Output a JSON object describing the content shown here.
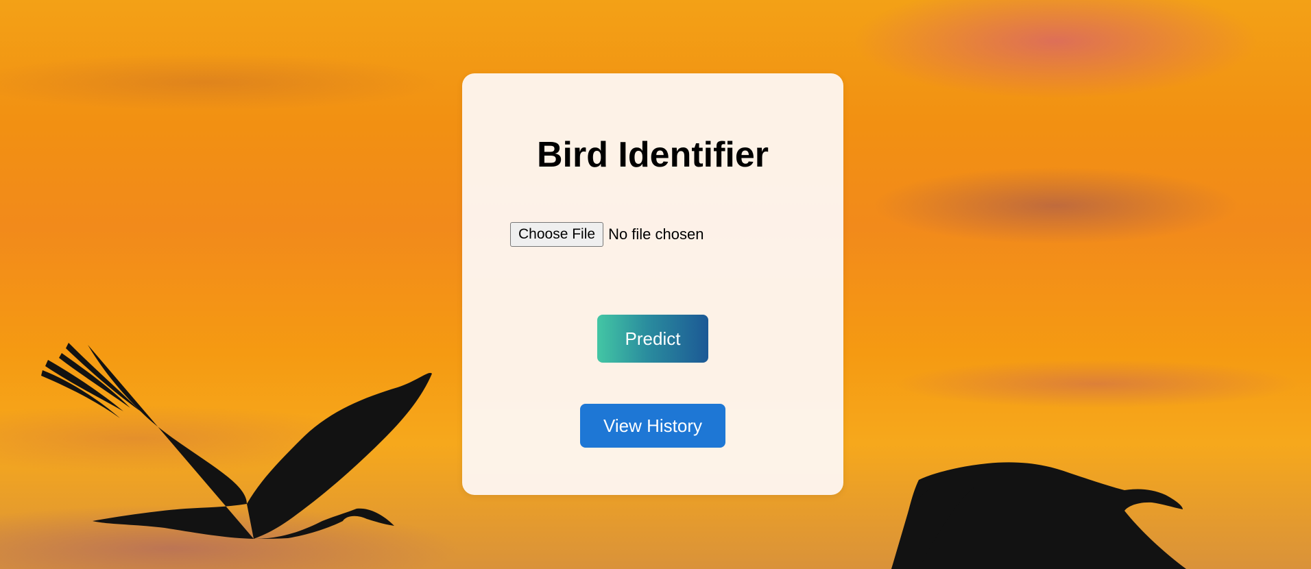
{
  "page": {
    "title": "Bird Identifier"
  },
  "upload": {
    "button_label": "Choose File",
    "status_text": "No file chosen"
  },
  "actions": {
    "predict_label": "Predict",
    "history_label": "View History"
  },
  "colors": {
    "predict_gradient_start": "#43c6a4",
    "predict_gradient_end": "#1c5995",
    "history_button": "#1e77d5",
    "card_background": "#fdf6f0",
    "sky_orange": "#f29012"
  },
  "background": {
    "scene": "sunset sky with flying bird silhouettes"
  }
}
